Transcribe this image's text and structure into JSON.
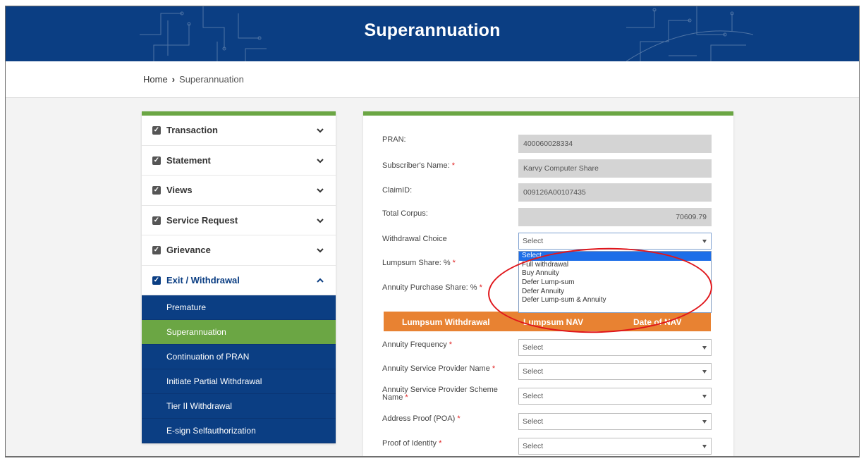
{
  "header": {
    "title": "Superannuation",
    "bg_color": "#0b3e83"
  },
  "breadcrumb": {
    "home": "Home",
    "current": "Superannuation"
  },
  "sidebar": {
    "accent_color": "#6ba644",
    "items": [
      {
        "label": "Transaction",
        "icon": "chevron-down-icon"
      },
      {
        "label": "Statement",
        "icon": "chevron-down-icon"
      },
      {
        "label": "Views",
        "icon": "chevron-down-icon"
      },
      {
        "label": "Service Request",
        "icon": "chevron-down-icon"
      },
      {
        "label": "Grievance",
        "icon": "chevron-down-icon"
      },
      {
        "label": "Exit / Withdrawal",
        "icon": "chevron-up-icon",
        "expanded": true
      }
    ],
    "subitems": [
      {
        "label": "Premature"
      },
      {
        "label": "Superannuation",
        "active": true
      },
      {
        "label": "Continuation of PRAN"
      },
      {
        "label": "Initiate Partial Withdrawal"
      },
      {
        "label": "Tier II Withdrawal"
      },
      {
        "label": "E-sign Selfauthorization"
      }
    ]
  },
  "form": {
    "pran": {
      "label": "PRAN:",
      "value": "400060028334"
    },
    "subscriber_name": {
      "label": "Subscriber's Name:",
      "required": "*",
      "value": "Karvy Computer Share"
    },
    "claim_id": {
      "label": "ClaimID:",
      "value": "009126A00107435"
    },
    "total_corpus": {
      "label": "Total Corpus:",
      "value": "70609.79"
    },
    "withdrawal_choice": {
      "label": "Withdrawal Choice",
      "value": "Select",
      "options": [
        "Select",
        "Full withdrawal",
        "Buy Annuity",
        "Defer Lump-sum",
        "Defer Annuity",
        "Defer Lump-sum & Annuity"
      ]
    },
    "lumpsum_share": {
      "label": "Lumpsum Share: %",
      "required": "*"
    },
    "annuity_purchase_share": {
      "label": "Annuity Purchase Share: %",
      "required": "*"
    },
    "table_header": {
      "col1": "Lumpsum Withdrawal",
      "col2": "Lumpsum NAV",
      "col3": "Date of NAV",
      "color": "#e88232"
    },
    "annuity_frequency": {
      "label": "Annuity Frequency",
      "required": "*",
      "value": "Select"
    },
    "asp_name": {
      "label": "Annuity Service Provider Name",
      "required": "*",
      "value": "Select"
    },
    "asp_scheme_name": {
      "label": "Annuity Service Provider Scheme Name",
      "required": "*",
      "value": "Select"
    },
    "address_proof": {
      "label": "Address Proof (POA)",
      "required": "*",
      "value": "Select"
    },
    "proof_of_identity": {
      "label": "Proof of Identity",
      "required": "*",
      "value": "Select"
    }
  },
  "annotation": {
    "ring_color": "#e0161b"
  }
}
